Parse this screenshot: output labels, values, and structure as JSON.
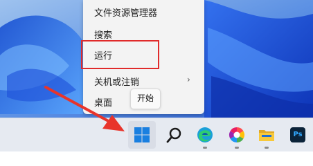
{
  "context_menu": {
    "items": [
      {
        "label": "文件资源管理器"
      },
      {
        "label": "搜索"
      },
      {
        "label": "运行"
      },
      {
        "label": "关机或注销",
        "submenu_chevron": "›"
      },
      {
        "label": "桌面"
      }
    ]
  },
  "tooltip": {
    "text": "开始"
  },
  "taskbar": {
    "items": [
      {
        "name": "start",
        "icon": "windows-logo-icon"
      },
      {
        "name": "search",
        "icon": "search-icon"
      },
      {
        "name": "edge",
        "icon": "edge-icon"
      },
      {
        "name": "colors-app",
        "icon": "color-wheel-icon"
      },
      {
        "name": "file-explorer",
        "icon": "folder-icon"
      },
      {
        "name": "photoshop",
        "icon": "photoshop-icon",
        "label": "Ps"
      }
    ]
  },
  "colors": {
    "highlight_border": "#e02b2b",
    "arrow": "#e8342b",
    "taskbar_bg": "#e6eaf1",
    "menu_bg": "#f3f3f3",
    "wallpaper_primary": "#1f5fe0"
  }
}
